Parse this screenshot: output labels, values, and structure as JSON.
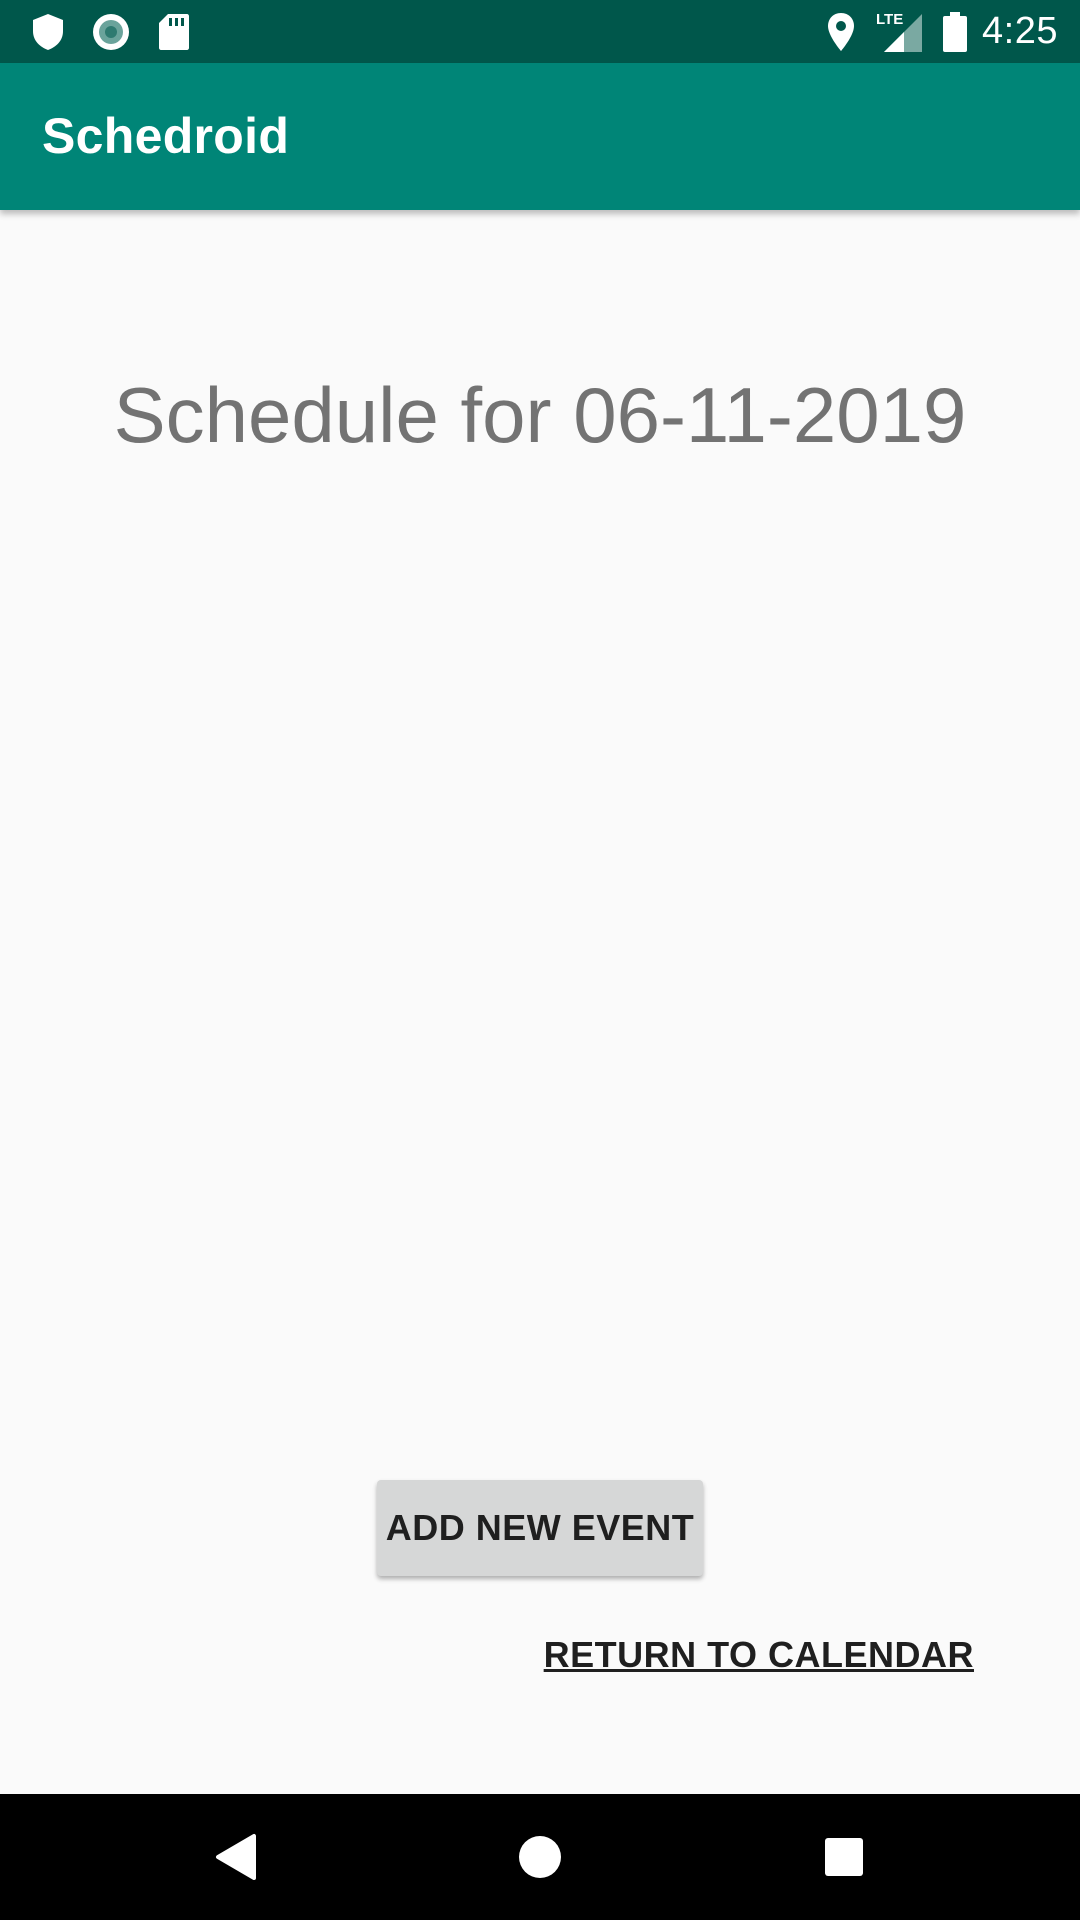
{
  "status_bar": {
    "time": "4:25",
    "network_label": "LTE",
    "icons": [
      "shield-icon",
      "record-icon",
      "sd-card-icon",
      "location-icon",
      "signal-icon",
      "battery-icon"
    ]
  },
  "app_bar": {
    "title": "Schedroid",
    "color": "#008577"
  },
  "main": {
    "schedule_title": "Schedule for 06-11-2019",
    "add_event_label": "ADD NEW EVENT",
    "return_label": "RETURN TO CALENDAR"
  },
  "nav_bar": {
    "icons": [
      "back-icon",
      "home-icon",
      "recents-icon"
    ]
  },
  "colors": {
    "status_bar": "#00574b",
    "app_bar": "#008577",
    "background": "#fafafa",
    "button": "#d6d7d7"
  }
}
